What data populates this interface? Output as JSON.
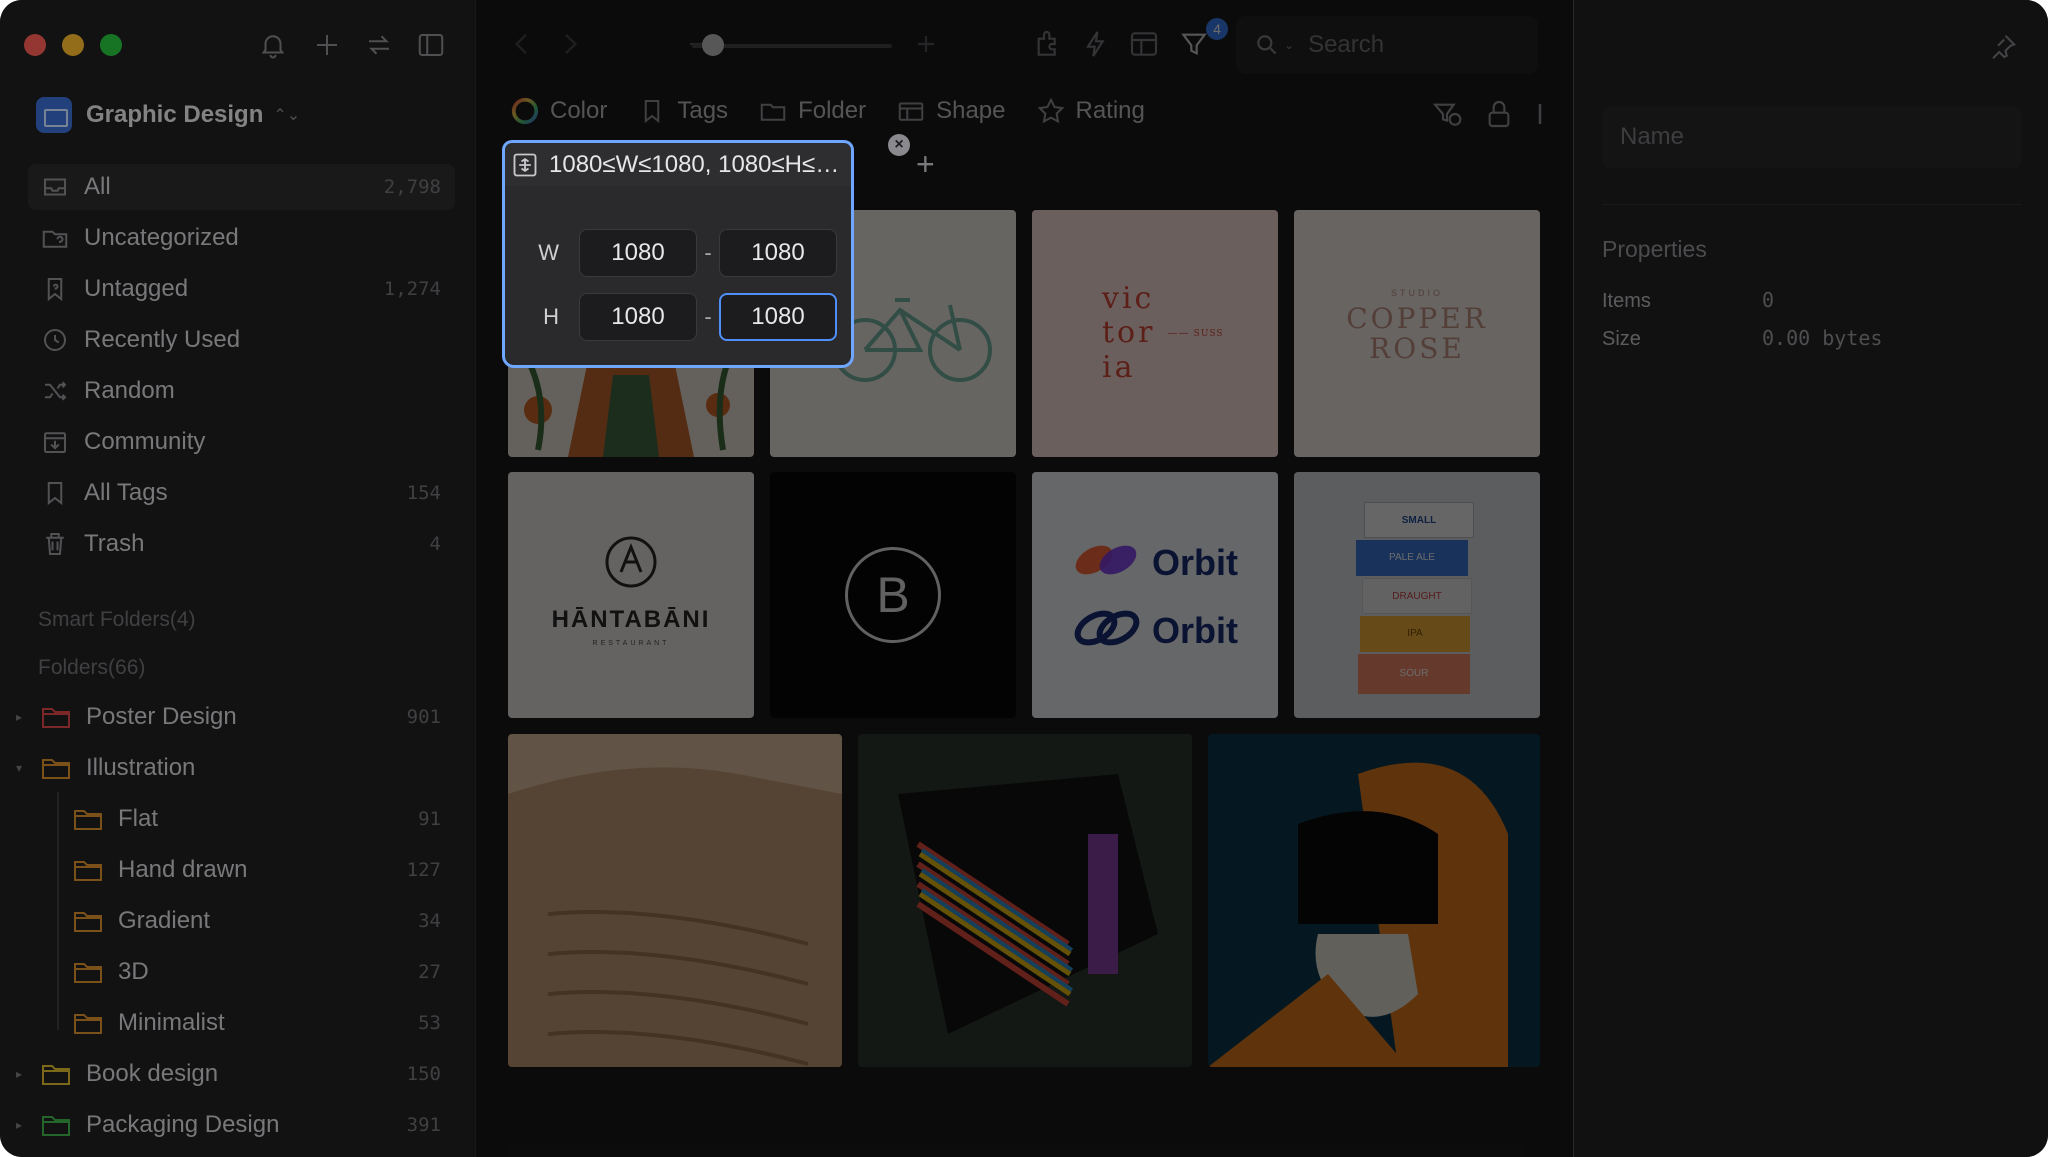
{
  "library": {
    "name": "Graphic Design"
  },
  "nav": [
    {
      "label": "All",
      "count": "2,798",
      "icon": "inbox-icon",
      "active": true
    },
    {
      "label": "Uncategorized",
      "count": "",
      "icon": "folder-question-icon"
    },
    {
      "label": "Untagged",
      "count": "1,274",
      "icon": "tag-question-icon"
    },
    {
      "label": "Recently Used",
      "count": "",
      "icon": "clock-icon"
    },
    {
      "label": "Random",
      "count": "",
      "icon": "shuffle-icon"
    },
    {
      "label": "Community",
      "count": "",
      "icon": "download-box-icon"
    },
    {
      "label": "All Tags",
      "count": "154",
      "icon": "bookmark-icon"
    },
    {
      "label": "Trash",
      "count": "4",
      "icon": "trash-icon"
    }
  ],
  "sections": {
    "smart": "Smart Folders(4)",
    "folders": "Folders(66)"
  },
  "tree": [
    {
      "label": "Poster Design",
      "count": "901",
      "color": "#d64545",
      "arrow": "▸",
      "sub": false
    },
    {
      "label": "Illustration",
      "count": "",
      "color": "#d58a2c",
      "arrow": "▾",
      "sub": false
    },
    {
      "label": "Flat",
      "count": "91",
      "color": "#d58a2c",
      "arrow": "",
      "sub": true
    },
    {
      "label": "Hand drawn",
      "count": "127",
      "color": "#d58a2c",
      "arrow": "",
      "sub": true
    },
    {
      "label": "Gradient",
      "count": "34",
      "color": "#d58a2c",
      "arrow": "",
      "sub": true
    },
    {
      "label": "3D",
      "count": "27",
      "color": "#d58a2c",
      "arrow": "",
      "sub": true
    },
    {
      "label": "Minimalist",
      "count": "53",
      "color": "#d58a2c",
      "arrow": "",
      "sub": true
    },
    {
      "label": "Book design",
      "count": "150",
      "color": "#d5b52c",
      "arrow": "▸",
      "sub": false
    },
    {
      "label": "Packaging Design",
      "count": "391",
      "color": "#3fae4a",
      "arrow": "▸",
      "sub": false
    }
  ],
  "toolbar": {
    "search_placeholder": "Search",
    "filter_badge": "4",
    "zoom_percent": 5
  },
  "filters": {
    "color": "Color",
    "tags": "Tags",
    "folder": "Folder",
    "shape": "Shape",
    "rating": "Rating",
    "active_chip": "1080≤W≤1080, 1080≤H≤10..."
  },
  "size_popover": {
    "w_label": "W",
    "h_label": "H",
    "w_min": "1080",
    "w_max": "1080",
    "h_min": "1080",
    "h_max": "1080",
    "dash": "-"
  },
  "thumbs": {
    "victoria": [
      "vic",
      "tor",
      "ia"
    ],
    "victoria_tag": "SUSS",
    "copper_top": "STUDIO",
    "copper": "COPPER",
    "rose": "ROSE",
    "hantabani": "HĀNTABĀNI",
    "hantabani_sub": "RESTAURANT",
    "b_logo": "B",
    "orbit": "Orbit",
    "box_labels": [
      "SMALL",
      "PALE ALE",
      "DRAUGHT",
      "IPA",
      "SOUR"
    ]
  },
  "inspector": {
    "name_placeholder": "Name",
    "properties_title": "Properties",
    "items_label": "Items",
    "items_value": "0",
    "size_label": "Size",
    "size_value": "0.00 bytes"
  },
  "colors": {
    "accent": "#3a82f7",
    "focus_ring": "#6fa6ff"
  }
}
